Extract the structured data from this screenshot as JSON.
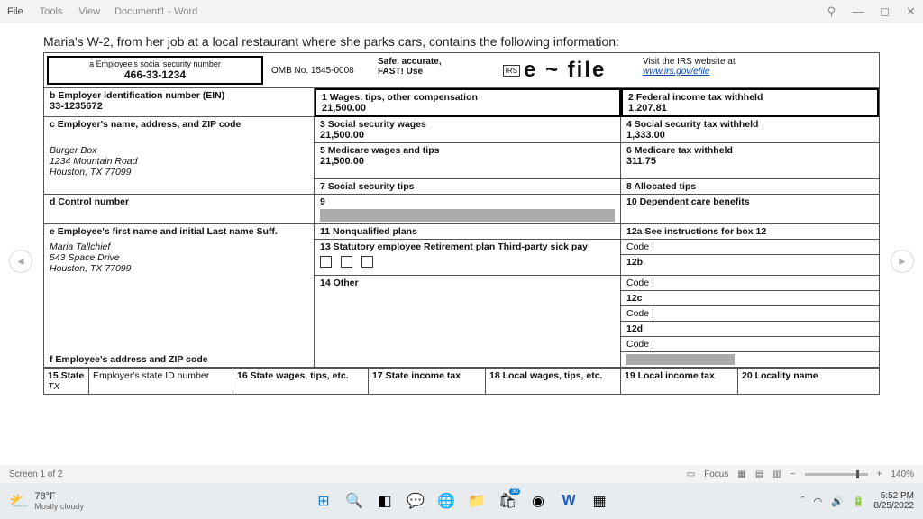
{
  "titlebar": {
    "menu": [
      "File",
      "Tools",
      "View"
    ],
    "doc_title": "Document1 - Word",
    "win_pin": "⚲",
    "win_min": "—",
    "win_max": "◻",
    "win_close": "✕"
  },
  "heading": "Maria's W-2, from her job at a local restaurant where she parks cars, contains the following information:",
  "w2": {
    "ssn_label": "a Employee's social security number",
    "ssn": "466-33-1234",
    "omb": "OMB No. 1545-0008",
    "safe1": "Safe, accurate,",
    "safe2": "FAST! Use",
    "irs_tag": "IRS",
    "efile": "e ~ file",
    "visit_label": "Visit the IRS website at",
    "visit_link": "www.irs.gov/efile",
    "b_label": "b Employer identification number (EIN)",
    "b_val": "33-1235672",
    "box1_label": "1 Wages, tips, other compensation",
    "box1_val": "21,500.00",
    "box2_label": "2 Federal income tax withheld",
    "box2_val": "1,207.81",
    "c_label": "c Employer's name, address, and ZIP code",
    "c_name": "Burger Box",
    "c_addr1": "1234 Mountain Road",
    "c_addr2": "Houston, TX 77099",
    "box3_label": "3 Social security wages",
    "box3_val": "21,500.00",
    "box4_label": "4 Social security tax withheld",
    "box4_val": "1,333.00",
    "box5_label": "5 Medicare wages and tips",
    "box5_val": "21,500.00",
    "box6_label": "6 Medicare tax withheld",
    "box6_val": "311.75",
    "box7_label": "7 Social security tips",
    "box8_label": "8 Allocated tips",
    "d_label": "d Control number",
    "box9_label": "9",
    "box10_label": "10 Dependent care benefits",
    "e_label": "e Employee's first name and initial   Last name   Suff.",
    "e_name": "Maria Tallchief",
    "e_addr1": "543 Space Drive",
    "e_addr2": "Houston, TX 77099",
    "box11_label": "11 Nonqualified plans",
    "box12a_label": "12a See instructions for box 12",
    "box13_label": "13 Statutory employee Retirement plan Third-party sick pay",
    "code_label": "Code  |",
    "box12b": "12b",
    "box14_label": "14 Other",
    "box12c": "12c",
    "box12d": "12d",
    "f_label": "f Employee's address and ZIP code",
    "s15_label": "15 State",
    "s15_val": "TX",
    "s_eid_label": "Employer's state ID number",
    "s16_label": "16 State wages, tips, etc.",
    "s17_label": "17 State income tax",
    "s18_label": "18 Local wages, tips, etc.",
    "s19_label": "19 Local income tax",
    "s20_label": "20 Locality name"
  },
  "statusbar": {
    "screen": "Screen 1 of 2",
    "focus": "Focus",
    "zoom": "140%"
  },
  "taskbar": {
    "temp": "78°F",
    "weather": "Mostly cloudy",
    "badge": "30",
    "time": "5:52 PM",
    "date": "8/25/2022"
  }
}
